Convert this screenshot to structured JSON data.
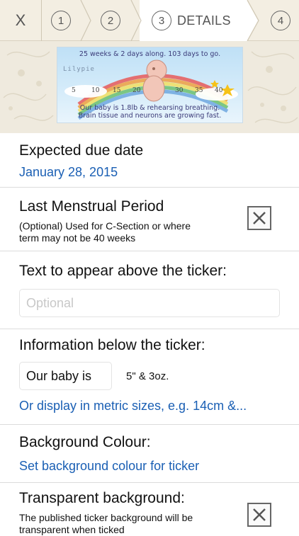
{
  "wizard": {
    "close_label": "X",
    "steps": [
      {
        "number": "1",
        "label": ""
      },
      {
        "number": "2",
        "label": ""
      },
      {
        "number": "3",
        "label": "DETAILS"
      },
      {
        "number": "4",
        "label": ""
      }
    ],
    "active_step": 3
  },
  "ticker": {
    "top_text": "25 weeks & 2 days along. 103 days to go.",
    "brand": "Lilypie",
    "scale": [
      "5",
      "10",
      "15",
      "20",
      "30",
      "35",
      "40"
    ],
    "bottom_line1": "Our baby is 1.8lb & rehearsing breathing.",
    "bottom_line2": "Brain tissue and neurons are growing fast."
  },
  "due_date": {
    "title": "Expected due date",
    "value": "January 28, 2015"
  },
  "lmp": {
    "title": "Last Menstrual Period",
    "note_line1": "(Optional) Used for C-Section or where",
    "note_line2": "term may not be 40 weeks",
    "checked": false
  },
  "text_above": {
    "title": "Text to appear above the ticker:",
    "placeholder": "Optional",
    "value": ""
  },
  "info_below": {
    "title": "Information below the ticker:",
    "prefix_value": "Our baby is",
    "size_text": "5\" & 3oz.",
    "metric_link": "Or display in metric sizes, e.g. 14cm &..."
  },
  "background_colour": {
    "title": "Background Colour:",
    "link": "Set background colour for ticker"
  },
  "transparent": {
    "title": "Transparent background:",
    "note_line1": "The published ticker background will be",
    "note_line2": "transparent when ticked",
    "checked": false
  },
  "colors": {
    "link": "#1a5fb4",
    "topbar_bg": "#f3eee2",
    "banner_bg": "#efeade"
  }
}
